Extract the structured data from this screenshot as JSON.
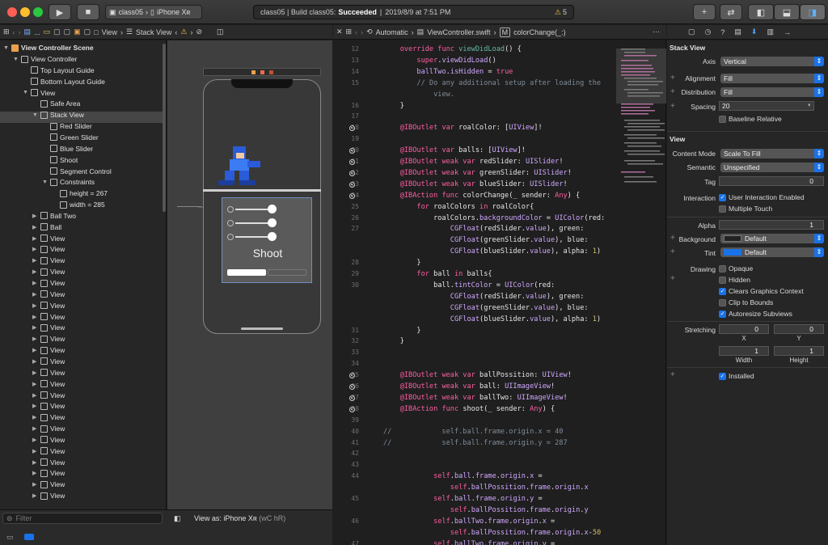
{
  "window": {
    "scheme_project": "class05",
    "scheme_device": "iPhone Xʀ",
    "activity_project": "class05 | Build class05:",
    "activity_status": "Succeeded",
    "activity_time": "2019/8/9 at 7:51 PM",
    "warning_count": "5"
  },
  "jumpbar_left": {
    "items": [
      "...",
      "View",
      "Stack View"
    ]
  },
  "jumpbar_right": {
    "items": [
      "Automatic",
      "ViewController.swift",
      "colorChange(_:)"
    ]
  },
  "outline": {
    "scene": "View Controller Scene",
    "items": [
      {
        "label": "View Controller",
        "indent": 1,
        "tri": "▼"
      },
      {
        "label": "Top Layout Guide",
        "indent": 2,
        "tri": ""
      },
      {
        "label": "Bottom Layout Guide",
        "indent": 2,
        "tri": ""
      },
      {
        "label": "View",
        "indent": 2,
        "tri": "▼"
      },
      {
        "label": "Safe Area",
        "indent": 3,
        "tri": ""
      },
      {
        "label": "Stack View",
        "indent": 3,
        "tri": "▼"
      },
      {
        "label": "Red Slider",
        "indent": 4,
        "tri": ""
      },
      {
        "label": "Green Slider",
        "indent": 4,
        "tri": ""
      },
      {
        "label": "Blue Slider",
        "indent": 4,
        "tri": ""
      },
      {
        "label": "Shoot",
        "indent": 4,
        "tri": ""
      },
      {
        "label": "Segment Control",
        "indent": 4,
        "tri": ""
      },
      {
        "label": "Constraints",
        "indent": 4,
        "tri": "▼"
      },
      {
        "label": "height = 267",
        "indent": 5,
        "tri": ""
      },
      {
        "label": "width = 285",
        "indent": 5,
        "tri": ""
      },
      {
        "label": "Ball Two",
        "indent": 3,
        "tri": "▶"
      },
      {
        "label": "Ball",
        "indent": 3,
        "tri": "▶"
      },
      {
        "label": "View",
        "indent": 3,
        "tri": "▶"
      },
      {
        "label": "View",
        "indent": 3,
        "tri": "▶"
      },
      {
        "label": "View",
        "indent": 3,
        "tri": "▶"
      },
      {
        "label": "View",
        "indent": 3,
        "tri": "▶"
      },
      {
        "label": "View",
        "indent": 3,
        "tri": "▶"
      },
      {
        "label": "View",
        "indent": 3,
        "tri": "▶"
      },
      {
        "label": "View",
        "indent": 3,
        "tri": "▶"
      },
      {
        "label": "View",
        "indent": 3,
        "tri": "▶"
      },
      {
        "label": "View",
        "indent": 3,
        "tri": "▶"
      },
      {
        "label": "View",
        "indent": 3,
        "tri": "▶"
      },
      {
        "label": "View",
        "indent": 3,
        "tri": "▶"
      },
      {
        "label": "View",
        "indent": 3,
        "tri": "▶"
      },
      {
        "label": "View",
        "indent": 3,
        "tri": "▶"
      },
      {
        "label": "View",
        "indent": 3,
        "tri": "▶"
      },
      {
        "label": "View",
        "indent": 3,
        "tri": "▶"
      },
      {
        "label": "View",
        "indent": 3,
        "tri": "▶"
      },
      {
        "label": "View",
        "indent": 3,
        "tri": "▶"
      },
      {
        "label": "View",
        "indent": 3,
        "tri": "▶"
      },
      {
        "label": "View",
        "indent": 3,
        "tri": "▶"
      },
      {
        "label": "View",
        "indent": 3,
        "tri": "▶"
      },
      {
        "label": "View",
        "indent": 3,
        "tri": "▶"
      },
      {
        "label": "View",
        "indent": 3,
        "tri": "▶"
      },
      {
        "label": "View",
        "indent": 3,
        "tri": "▶"
      },
      {
        "label": "View",
        "indent": 3,
        "tri": "▶"
      }
    ]
  },
  "filter_placeholder": "Filter",
  "canvas": {
    "button_title": "Shoot",
    "view_as": "View as: iPhone Xʀ",
    "view_as_hint": "(wC hR)"
  },
  "code_lines": [
    {
      "n": "12",
      "dot": false,
      "html": "    <span class='kw'>override func</span> <span class='fn'>viewDidLoad</span>() {"
    },
    {
      "n": "13",
      "dot": false,
      "html": "        <span class='kw'>super</span>.<span class='ty'>viewDidLoad</span>()"
    },
    {
      "n": "14",
      "dot": false,
      "html": "        <span class='ty'>ballTwo</span>.<span class='ty'>isHidden</span> = <span class='kw'>true</span>"
    },
    {
      "n": "15",
      "dot": false,
      "html": "        <span class='cm'>// Do any additional setup after loading the</span>"
    },
    {
      "n": "",
      "dot": false,
      "html": "            <span class='cm'>view.</span>"
    },
    {
      "n": "16",
      "dot": false,
      "html": "    }"
    },
    {
      "n": "17",
      "dot": false,
      "html": ""
    },
    {
      "n": "18",
      "dot": true,
      "html": "    <span class='kw'>@IBOutlet var</span> roalColor: [<span class='ty'>UIView</span>]!"
    },
    {
      "n": "19",
      "dot": false,
      "html": ""
    },
    {
      "n": "20",
      "dot": true,
      "html": "    <span class='kw'>@IBOutlet var</span> balls: [<span class='ty'>UIView</span>]!"
    },
    {
      "n": "21",
      "dot": true,
      "html": "    <span class='kw'>@IBOutlet weak var</span> redSlider: <span class='ty'>UISlider</span>!"
    },
    {
      "n": "22",
      "dot": true,
      "html": "    <span class='kw'>@IBOutlet weak var</span> greenSlider: <span class='ty'>UISlider</span>!"
    },
    {
      "n": "23",
      "dot": true,
      "html": "    <span class='kw'>@IBOutlet weak var</span> blueSlider: <span class='ty'>UISlider</span>!"
    },
    {
      "n": "24",
      "dot": true,
      "html": "    <span class='kw'>@IBAction func</span> colorChange(_ sender: <span class='kw'>Any</span>) {"
    },
    {
      "n": "25",
      "dot": false,
      "html": "        <span class='kw'>for</span> roalColors <span class='kw'>in</span> roalColor{"
    },
    {
      "n": "26",
      "dot": false,
      "html": "            roalColors.<span class='ty'>backgroundColor</span> = <span class='ty'>UIColor</span>(red:"
    },
    {
      "n": "27",
      "dot": false,
      "html": "                <span class='ty'>CGFloat</span>(redSlider.<span class='ty'>value</span>), green:"
    },
    {
      "n": "",
      "dot": false,
      "html": "                <span class='ty'>CGFloat</span>(greenSlider.<span class='ty'>value</span>), blue:"
    },
    {
      "n": "",
      "dot": false,
      "html": "                <span class='ty'>CGFloat</span>(blueSlider.<span class='ty'>value</span>), alpha: <span class='nu'>1</span>)"
    },
    {
      "n": "28",
      "dot": false,
      "html": "        }"
    },
    {
      "n": "29",
      "dot": false,
      "html": "        <span class='kw'>for</span> ball <span class='kw'>in</span> balls{"
    },
    {
      "n": "30",
      "dot": false,
      "html": "            ball.<span class='ty'>tintColor</span> = <span class='ty'>UIColor</span>(red:"
    },
    {
      "n": "",
      "dot": false,
      "html": "                <span class='ty'>CGFloat</span>(redSlider.<span class='ty'>value</span>), green:"
    },
    {
      "n": "",
      "dot": false,
      "html": "                <span class='ty'>CGFloat</span>(greenSlider.<span class='ty'>value</span>), blue:"
    },
    {
      "n": "",
      "dot": false,
      "html": "                <span class='ty'>CGFloat</span>(blueSlider.<span class='ty'>value</span>), alpha: <span class='nu'>1</span>)"
    },
    {
      "n": "31",
      "dot": false,
      "html": "        }"
    },
    {
      "n": "32",
      "dot": false,
      "html": "    }"
    },
    {
      "n": "33",
      "dot": false,
      "html": ""
    },
    {
      "n": "34",
      "dot": false,
      "html": ""
    },
    {
      "n": "35",
      "dot": true,
      "html": "    <span class='kw'>@IBOutlet weak var</span> ballPossition: <span class='ty'>UIView</span>!"
    },
    {
      "n": "36",
      "dot": true,
      "html": "    <span class='kw'>@IBOutlet weak var</span> ball: <span class='ty'>UIImageView</span>!"
    },
    {
      "n": "37",
      "dot": true,
      "html": "    <span class='kw'>@IBOutlet weak var</span> ballTwo: <span class='ty'>UIImageView</span>!"
    },
    {
      "n": "38",
      "dot": true,
      "html": "    <span class='kw'>@IBAction func</span> shoot(_ sender: <span class='kw'>Any</span>) {"
    },
    {
      "n": "39",
      "dot": false,
      "html": ""
    },
    {
      "n": "40",
      "dot": false,
      "html": "<span class='cm'>//            self.ball.frame.origin.x = 40</span>"
    },
    {
      "n": "41",
      "dot": false,
      "html": "<span class='cm'>//            self.ball.frame.origin.y = 287</span>"
    },
    {
      "n": "42",
      "dot": false,
      "html": ""
    },
    {
      "n": "43",
      "dot": false,
      "html": ""
    },
    {
      "n": "44",
      "dot": false,
      "html": "            <span class='kw'>self</span>.<span class='ty'>ball</span>.<span class='ty'>frame</span>.<span class='ty'>origin</span>.<span class='ty'>x</span> ="
    },
    {
      "n": "",
      "dot": false,
      "html": "                <span class='kw'>self</span>.<span class='ty'>ballPossition</span>.<span class='ty'>frame</span>.<span class='ty'>origin</span>.<span class='ty'>x</span>"
    },
    {
      "n": "45",
      "dot": false,
      "html": "            <span class='kw'>self</span>.<span class='ty'>ball</span>.<span class='ty'>frame</span>.<span class='ty'>origin</span>.<span class='ty'>y</span> ="
    },
    {
      "n": "",
      "dot": false,
      "html": "                <span class='kw'>self</span>.<span class='ty'>ballPossition</span>.<span class='ty'>frame</span>.<span class='ty'>origin</span>.<span class='ty'>y</span>"
    },
    {
      "n": "46",
      "dot": false,
      "html": "            <span class='kw'>self</span>.<span class='ty'>ballTwo</span>.<span class='ty'>frame</span>.<span class='ty'>origin</span>.<span class='ty'>x</span> ="
    },
    {
      "n": "",
      "dot": false,
      "html": "                <span class='kw'>self</span>.<span class='ty'>ballPossition</span>.<span class='ty'>frame</span>.<span class='ty'>origin</span>.<span class='ty'>x</span>-<span class='nu'>50</span>"
    },
    {
      "n": "47",
      "dot": false,
      "html": "            <span class='kw'>self</span>.<span class='ty'>ballTwo</span>.<span class='ty'>frame</span>.<span class='ty'>origin</span>.<span class='ty'>y</span> ="
    }
  ],
  "inspector": {
    "stack_title": "Stack View",
    "axis_label": "Axis",
    "axis": "Vertical",
    "alignment_label": "Alignment",
    "alignment": "Fill",
    "distribution_label": "Distribution",
    "distribution": "Fill",
    "spacing_label": "Spacing",
    "spacing": "20",
    "baseline": "Baseline Relative",
    "view_title": "View",
    "content_mode_label": "Content Mode",
    "content_mode": "Scale To Fill",
    "semantic_label": "Semantic",
    "semantic": "Unspecified",
    "tag_label": "Tag",
    "tag": "0",
    "interaction_label": "Interaction",
    "uie": "User Interaction Enabled",
    "multi_touch": "Multiple Touch",
    "alpha_label": "Alpha",
    "alpha": "1",
    "background_label": "Background",
    "background": "Default",
    "tint_label": "Tint",
    "tint": "Default",
    "drawing_label": "Drawing",
    "opaque": "Opaque",
    "hidden": "Hidden",
    "clears": "Clears Graphics Context",
    "clip": "Clip to Bounds",
    "autoresize": "Autoresize Subviews",
    "stretching_label": "Stretching",
    "sx": "0",
    "sy": "0",
    "sw": "1",
    "sh": "1",
    "x_label": "X",
    "y_label": "Y",
    "w_label": "Width",
    "h_label": "Height",
    "installed": "Installed"
  },
  "colors": {
    "accent": "#1a72e8",
    "keyword": "#fc5fa3",
    "type": "#d0a8ff",
    "comment": "#7f8c98"
  }
}
